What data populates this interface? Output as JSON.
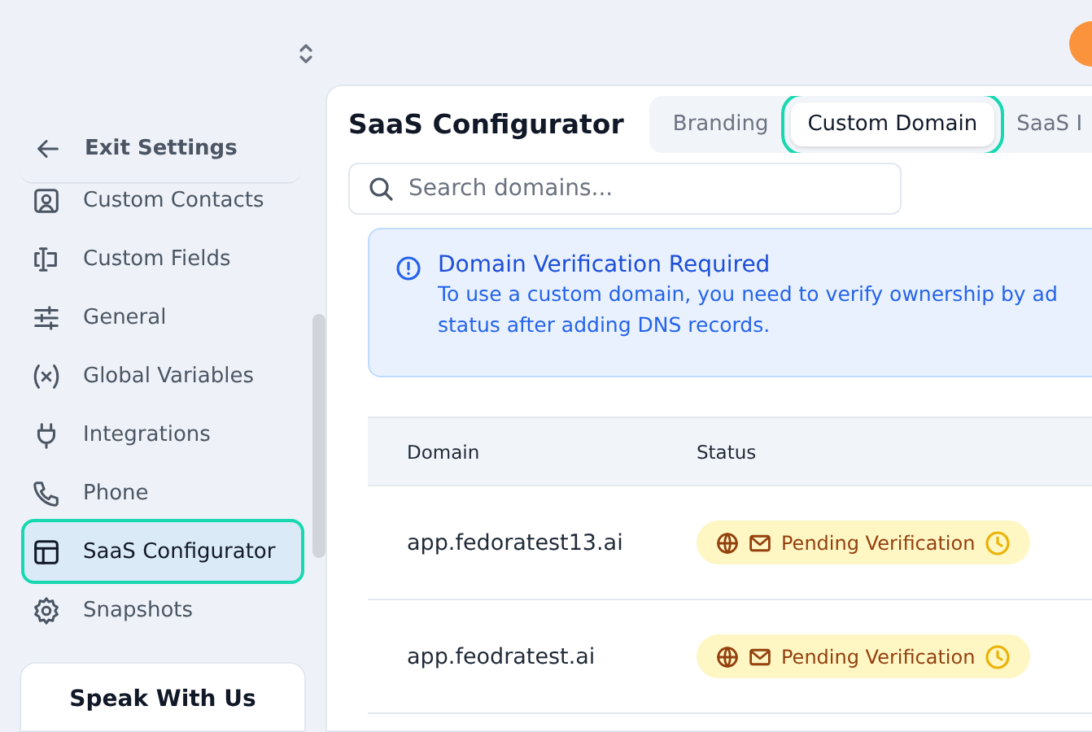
{
  "sidebar": {
    "back": {
      "label": "Exit Settings"
    },
    "items": [
      {
        "label": "Custom Contacts",
        "kind": "contacts",
        "selected": false
      },
      {
        "label": "Custom Fields",
        "kind": "fields",
        "selected": false
      },
      {
        "label": "General",
        "kind": "sliders",
        "selected": false
      },
      {
        "label": "Global Variables",
        "kind": "variable",
        "selected": false
      },
      {
        "label": "Integrations",
        "kind": "plug",
        "selected": false
      },
      {
        "label": "Phone",
        "kind": "phone",
        "selected": false
      },
      {
        "label": "SaaS Configurator",
        "kind": "layout",
        "selected": true
      },
      {
        "label": "Snapshots",
        "kind": "gear",
        "selected": false
      }
    ],
    "promo": {
      "title": "Speak With Us"
    }
  },
  "main": {
    "title": "SaaS Configurator",
    "tabs": [
      {
        "label": "Branding",
        "selected": false
      },
      {
        "label": "Custom Domain",
        "selected": true
      },
      {
        "label": "SaaS I",
        "selected": false
      }
    ],
    "search": {
      "placeholder": "Search domains..."
    },
    "alert": {
      "title": "Domain Verification Required",
      "text": "To use a custom domain, you need to verify ownership by ad",
      "text_2": "status after adding DNS records."
    },
    "table": {
      "columns": [
        "Domain",
        "Status"
      ],
      "rows": [
        {
          "domain": "app.fedoratest13.ai",
          "status": "Pending Verification"
        },
        {
          "domain": "app.feodratest.ai",
          "status": "Pending Verification"
        }
      ]
    }
  }
}
